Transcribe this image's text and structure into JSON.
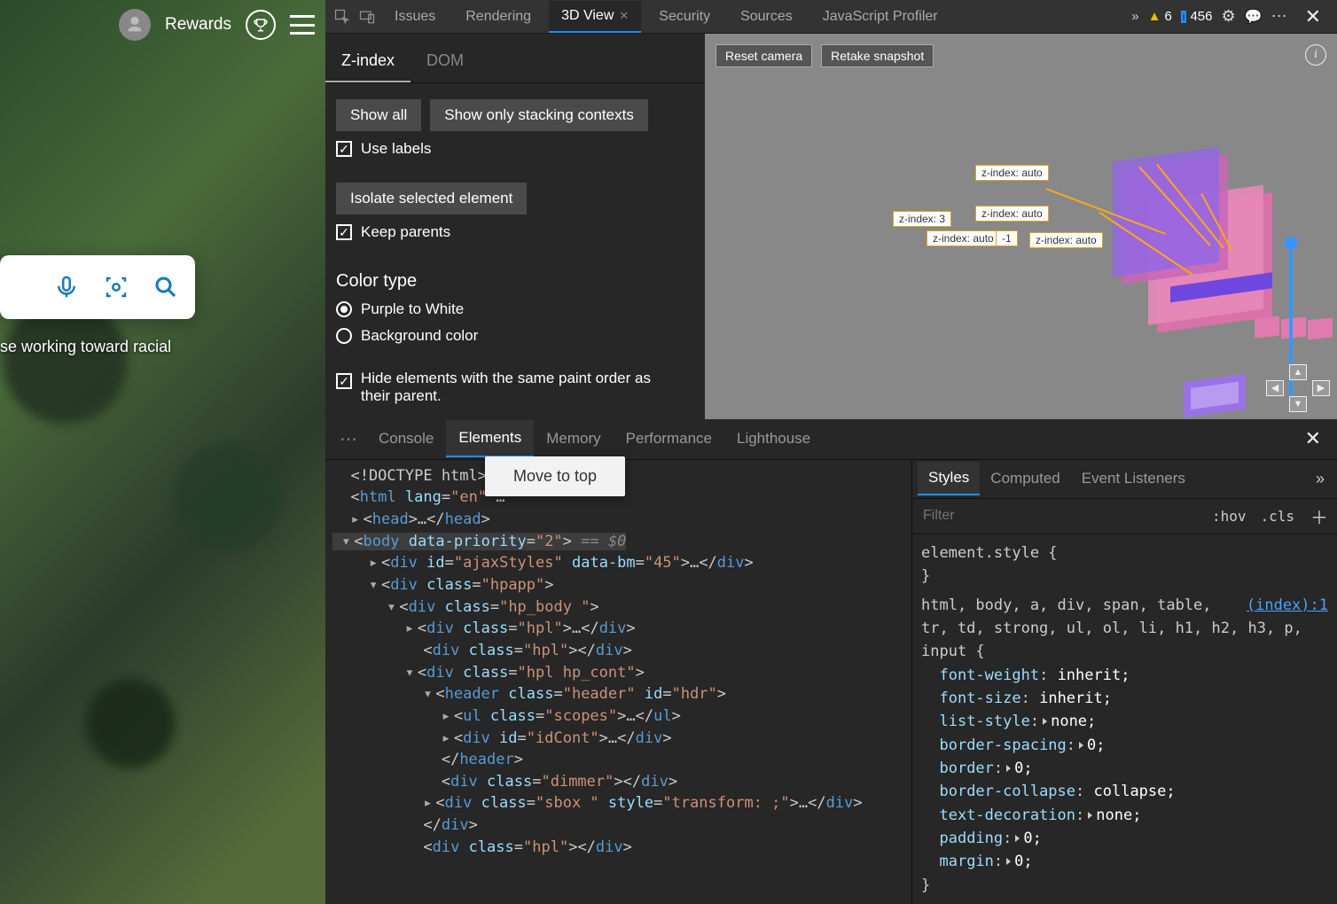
{
  "bing": {
    "rewards_label": "Rewards",
    "caption": "se working toward racial"
  },
  "top_tabs": {
    "issues": "Issues",
    "rendering": "Rendering",
    "threed": "3D View",
    "security": "Security",
    "sources": "Sources",
    "jsprof": "JavaScript Profiler",
    "warn_count": "6",
    "info_count": "456"
  },
  "zpanel": {
    "tab_zindex": "Z-index",
    "tab_dom": "DOM",
    "show_all": "Show all",
    "show_only": "Show only stacking contexts",
    "use_labels": "Use labels",
    "isolate": "Isolate selected element",
    "keep_parents": "Keep parents",
    "color_type_hdr": "Color type",
    "purple_white": "Purple to White",
    "bgcolor": "Background color",
    "hide_same": "Hide elements with the same paint order as their parent."
  },
  "viewport": {
    "reset": "Reset camera",
    "retake": "Retake snapshot",
    "labels": {
      "a1": "z-index: auto",
      "a2": "z-index: auto",
      "a3": "z-index: 3",
      "a4": "z-index: auto",
      "a5": "-1",
      "a6": "z-index: auto"
    }
  },
  "bottom_tabs": {
    "console": "Console",
    "elements": "Elements",
    "memory": "Memory",
    "performance": "Performance",
    "lighthouse": "Lighthouse",
    "tooltip": "Move to top"
  },
  "styles_panel": {
    "tab_styles": "Styles",
    "tab_computed": "Computed",
    "tab_events": "Event Listeners",
    "filter_placeholder": "Filter",
    "hov": ":hov",
    "cls": ".cls",
    "element_style": "element.style {",
    "element_style_close": "}",
    "selector_line1": "html, body, a, div, span, table,",
    "selector_line2": "tr, td, strong, ul, ol, li, h1, h2, h3, p,",
    "selector_line3": "input {",
    "link": "(index):1",
    "p_font_weight": "font-weight",
    "v_font_weight": "inherit;",
    "p_font_size": "font-size",
    "v_font_size": "inherit;",
    "p_list_style": "list-style",
    "v_list_style": "none;",
    "p_border_spacing": "border-spacing",
    "v_border_spacing": "0;",
    "p_border": "border",
    "v_border": "0;",
    "p_border_collapse": "border-collapse",
    "v_border_collapse": "collapse;",
    "p_text_decoration": "text-decoration",
    "v_text_decoration": "none;",
    "p_padding": "padding",
    "v_padding": "0;",
    "p_margin": "margin",
    "v_margin": "0;",
    "close_brace": "}"
  }
}
